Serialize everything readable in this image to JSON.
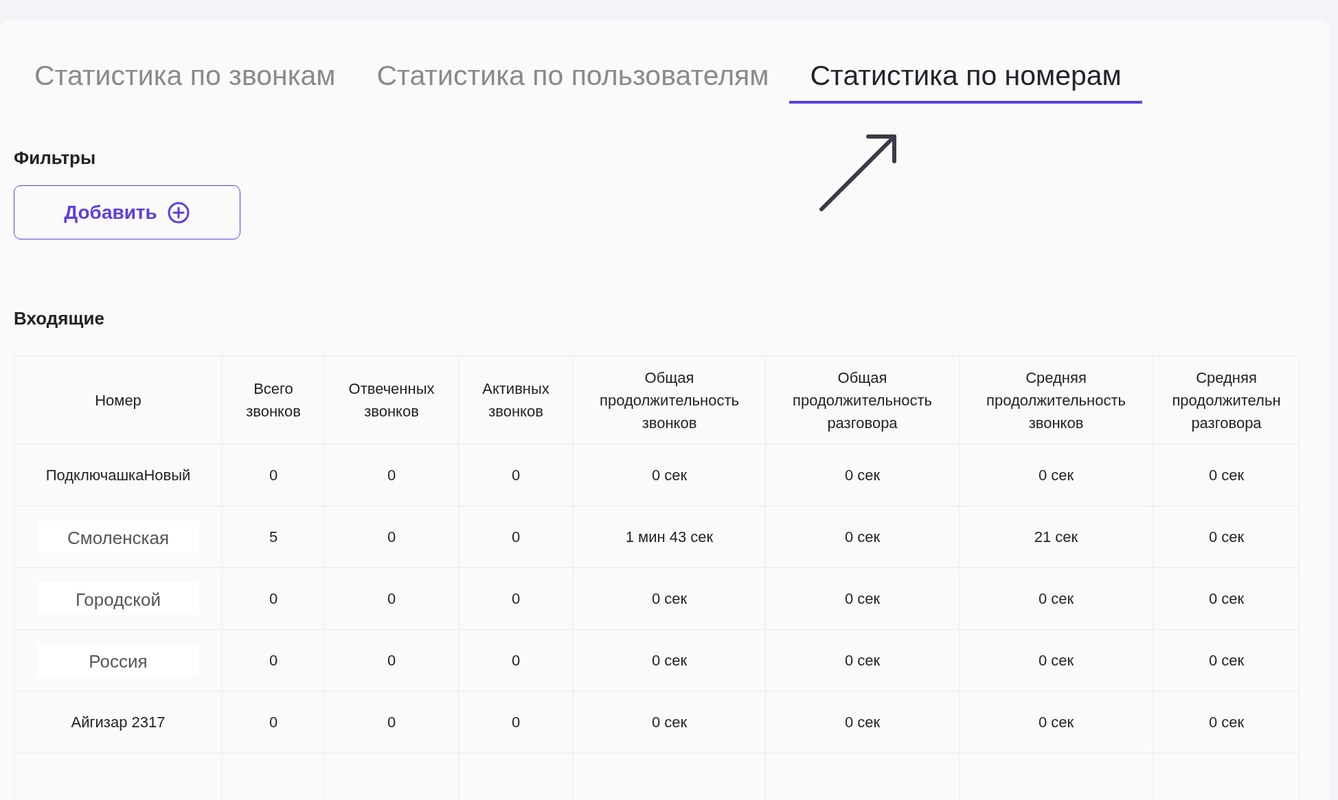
{
  "tabs": [
    {
      "label": "Статистика по звонкам",
      "selected": false
    },
    {
      "label": "Статистика по пользователям",
      "selected": false
    },
    {
      "label": "Статистика по номерам",
      "selected": true
    }
  ],
  "filters": {
    "title": "Фильтры",
    "add_button": "Добавить"
  },
  "incoming": {
    "title": "Входящие",
    "columns": [
      "Номер",
      "Всего звонков",
      "Отвеченных звонков",
      "Активных звонков",
      "Общая продолжительность звонков",
      "Общая продолжительность разговора",
      "Средняя продолжительность звонков",
      "Средняя продолжительн разговора"
    ],
    "rows": [
      {
        "kind": "text",
        "cells": [
          "ПодключашкаНовый",
          "0",
          "0",
          "0",
          "0 сек",
          "0 сек",
          "0 сек",
          "0 сек"
        ]
      },
      {
        "kind": "pasted",
        "cells": [
          "Смоленская",
          "5",
          "0",
          "0",
          "1 мин 43 сек",
          "0 сек",
          "21 сек",
          "0 сек"
        ]
      },
      {
        "kind": "pasted",
        "cells": [
          "Городской",
          "0",
          "0",
          "0",
          "0 сек",
          "0 сек",
          "0 сек",
          "0 сек"
        ]
      },
      {
        "kind": "pasted",
        "cells": [
          "Россия",
          "0",
          "0",
          "0",
          "0 сек",
          "0 сек",
          "0 сек",
          "0 сек"
        ]
      },
      {
        "kind": "text",
        "cells": [
          "Айгизар 2317",
          "0",
          "0",
          "0",
          "0 сек",
          "0 сек",
          "0 сек",
          "0 сек"
        ]
      }
    ]
  }
}
